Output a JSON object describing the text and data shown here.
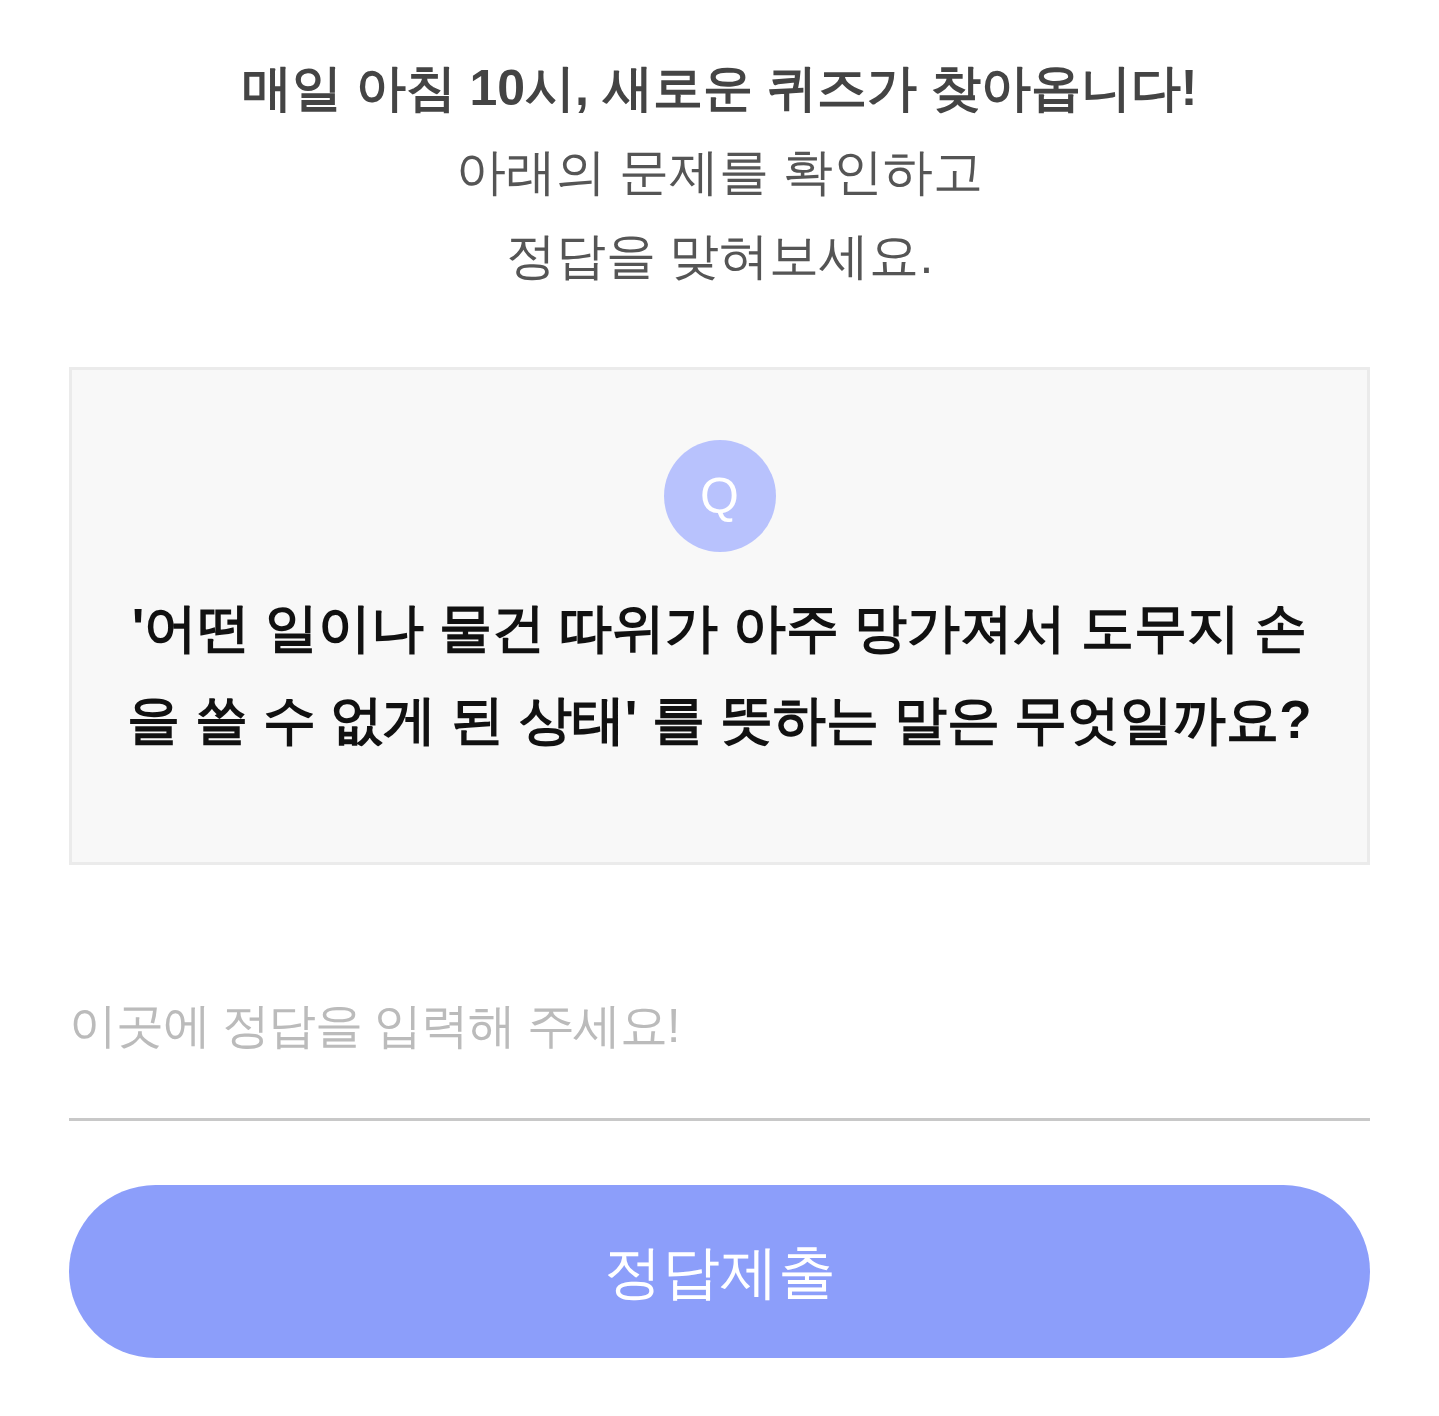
{
  "header": {
    "title": "매일 아침 10시, 새로운 퀴즈가 찾아옵니다!",
    "lines": [
      "아래의 문제를 확인하고",
      "정답을 맞혀보세요."
    ]
  },
  "question": {
    "badge": "Q",
    "text": "'어떤 일이나 물건 따위가 아주 망가져서 도무지 손을 쓸 수 없게 된 상태' 를 뜻하는 말은 무엇일까요?"
  },
  "answer_field": {
    "placeholder": "이곳에 정답을 입력해 주세요!"
  },
  "submit_button": {
    "label": "정답제출"
  }
}
